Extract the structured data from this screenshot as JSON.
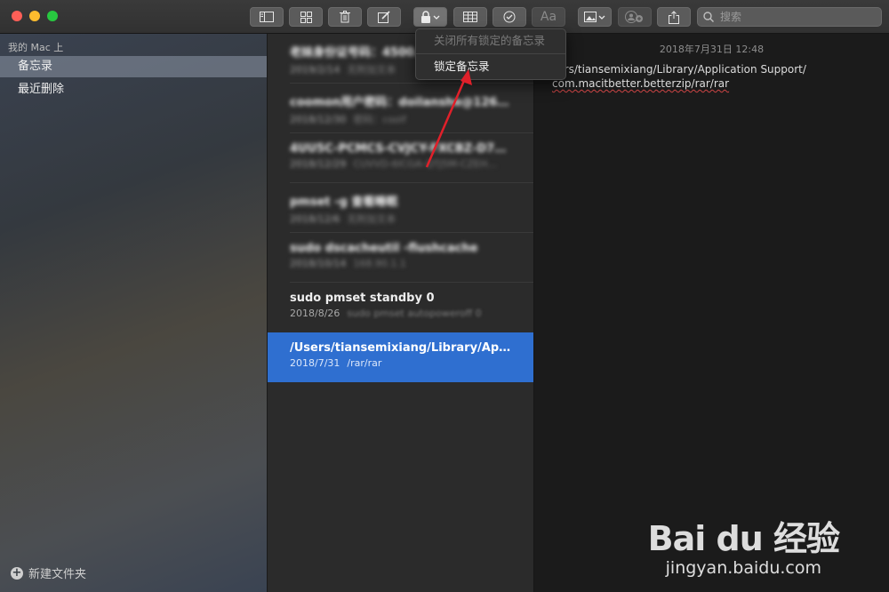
{
  "toolbar": {
    "search_placeholder": "搜索",
    "font_button_label": "Aa"
  },
  "lock_menu": {
    "items": [
      {
        "label": "关闭所有锁定的备忘录",
        "enabled": false
      },
      {
        "label": "锁定备忘录",
        "enabled": true
      }
    ]
  },
  "sidebar": {
    "section_title": "我的 Mac 上",
    "items": [
      {
        "label": "备忘录",
        "selected": true
      },
      {
        "label": "最近删除",
        "selected": false
      }
    ],
    "new_folder_label": "新建文件夹"
  },
  "notes": [
    {
      "title": "老妹身份证号码：4500…",
      "date": "2019/2/14",
      "preview": "无附加文本",
      "blurred": true
    },
    {
      "title": "coomon用户密码：doilanshe@126.com",
      "date": "2018/12/30",
      "preview": "密码：coolf",
      "blurred": true
    },
    {
      "title": "4UU5C-PCMCS-CVJCY-FXCBZ-D7CA4",
      "date": "2018/12/29",
      "preview": "CUVVD-6ICGA-QTJ5M-CZEH…",
      "blurred": true
    },
    {
      "title": "pmset -g 查看睡眠",
      "date": "2018/12/6",
      "preview": "无附加文本",
      "blurred": true
    },
    {
      "title": "sudo dscacheutil -flushcache",
      "date": "2018/10/14",
      "preview": "168.90.1.1",
      "blurred": true
    },
    {
      "title": "sudo pmset standby 0",
      "date": "2018/8/26",
      "preview": "sudo pmset autopoweroff 0",
      "blurred": false
    },
    {
      "title": "/Users/tiansemixiang/Library/Applica...",
      "date": "2018/7/31",
      "preview": "/rar/rar",
      "blurred": false,
      "selected": true
    }
  ],
  "editor": {
    "timestamp": "2018年7月31日 12:48",
    "line1": "sers/tiansemixiang/Library/Application Support/",
    "line2": "com.macitbetter.betterzip/rar/rar"
  },
  "watermark": {
    "logo": "Bai du 经验",
    "url": "jingyan.baidu.com"
  },
  "colors": {
    "selection_blue": "#2f6fd0",
    "annotation_arrow": "#e0202a"
  }
}
